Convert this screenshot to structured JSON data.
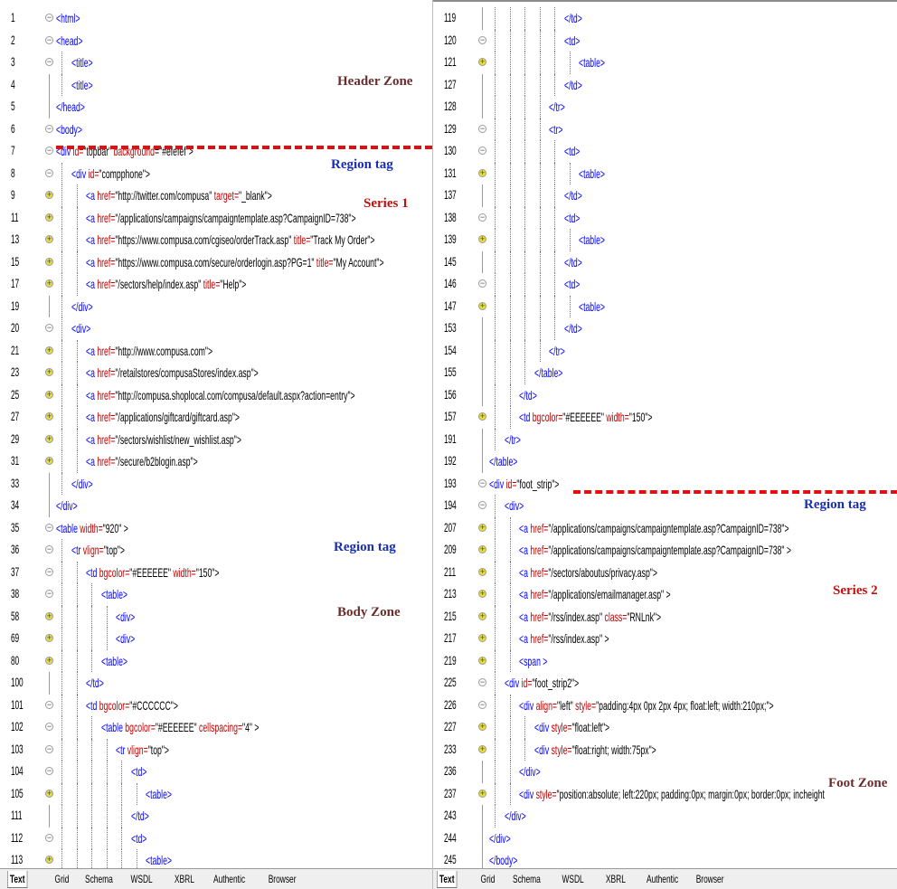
{
  "left": {
    "lines": [
      {
        "n": "1",
        "g": "exp",
        "d": 0,
        "t": [
          [
            "tag",
            "<html>"
          ]
        ]
      },
      {
        "n": "2",
        "g": "exp",
        "d": 0,
        "t": [
          [
            "tag",
            "<head>"
          ]
        ]
      },
      {
        "n": "3",
        "g": "exp",
        "d": 1,
        "t": [
          [
            "tag",
            "<title>"
          ]
        ]
      },
      {
        "n": "4",
        "g": "bar",
        "d": 1,
        "t": [
          [
            "tag",
            "<title>"
          ]
        ]
      },
      {
        "n": "5",
        "g": "bar",
        "d": 0,
        "t": [
          [
            "tag",
            "</head>"
          ]
        ]
      },
      {
        "n": "6",
        "g": "exp",
        "d": 0,
        "t": [
          [
            "tag",
            "<body>"
          ]
        ]
      },
      {
        "n": "7",
        "g": "exp",
        "d": 0,
        "t": [
          [
            "tag",
            "<div "
          ],
          [
            "a",
            "id="
          ],
          [
            "v",
            "\"topbar\" "
          ],
          [
            "a",
            "background"
          ],
          [
            "v",
            "=\"#efefef\">"
          ]
        ]
      },
      {
        "n": "8",
        "g": "exp",
        "d": 1,
        "t": [
          [
            "tag",
            "<div "
          ],
          [
            "a",
            "id="
          ],
          [
            "v",
            "\"compphone\">"
          ]
        ]
      },
      {
        "n": "9",
        "g": "col",
        "d": 2,
        "t": [
          [
            "tag",
            "<a "
          ],
          [
            "a",
            "href="
          ],
          [
            "v",
            "\"http://twitter.com/compusa\" "
          ],
          [
            "a",
            "target="
          ],
          [
            "v",
            "\"_blank\">"
          ]
        ]
      },
      {
        "n": "11",
        "g": "col",
        "d": 2,
        "t": [
          [
            "tag",
            "<a "
          ],
          [
            "a",
            "href="
          ],
          [
            "v",
            "\"/applications/campaigns/campaigntemplate.asp?CampaignID=738\">"
          ]
        ]
      },
      {
        "n": "13",
        "g": "col",
        "d": 2,
        "t": [
          [
            "tag",
            "<a "
          ],
          [
            "a",
            "href="
          ],
          [
            "v",
            "\"https://www.compusa.com/cgiseo/orderTrack.asp\" "
          ],
          [
            "a",
            "title="
          ],
          [
            "v",
            "\"Track My Order\">"
          ]
        ]
      },
      {
        "n": "15",
        "g": "col",
        "d": 2,
        "t": [
          [
            "tag",
            "<a "
          ],
          [
            "a",
            "href="
          ],
          [
            "v",
            "\"https://www.compusa.com/secure/orderlogin.asp?PG=1\" "
          ],
          [
            "a",
            "title="
          ],
          [
            "v",
            "\"My Account\">"
          ]
        ]
      },
      {
        "n": "17",
        "g": "col",
        "d": 2,
        "t": [
          [
            "tag",
            "<a "
          ],
          [
            "a",
            "href="
          ],
          [
            "v",
            "\"/sectors/help/index.asp\" "
          ],
          [
            "a",
            "title="
          ],
          [
            "v",
            "\"Help\">"
          ]
        ]
      },
      {
        "n": "19",
        "g": "bar",
        "d": 1,
        "t": [
          [
            "tag",
            "</div>"
          ]
        ]
      },
      {
        "n": "20",
        "g": "exp",
        "d": 1,
        "t": [
          [
            "tag",
            "<div>"
          ]
        ]
      },
      {
        "n": "21",
        "g": "col",
        "d": 2,
        "t": [
          [
            "tag",
            "<a "
          ],
          [
            "a",
            "href="
          ],
          [
            "v",
            "\"http://www.compusa.com\">"
          ]
        ]
      },
      {
        "n": "23",
        "g": "col",
        "d": 2,
        "t": [
          [
            "tag",
            "<a "
          ],
          [
            "a",
            "href="
          ],
          [
            "v",
            "\"/retailstores/compusaStores/index.asp\">"
          ]
        ]
      },
      {
        "n": "25",
        "g": "col",
        "d": 2,
        "t": [
          [
            "tag",
            "<a "
          ],
          [
            "a",
            "href="
          ],
          [
            "v",
            "\"http://compusa.shoplocal.com/compusa/default.aspx?action=entry\">"
          ]
        ]
      },
      {
        "n": "27",
        "g": "col",
        "d": 2,
        "t": [
          [
            "tag",
            "<a "
          ],
          [
            "a",
            "href="
          ],
          [
            "v",
            "\"/applications/giftcard/giftcard.asp\">"
          ]
        ]
      },
      {
        "n": "29",
        "g": "col",
        "d": 2,
        "t": [
          [
            "tag",
            "<a "
          ],
          [
            "a",
            "href="
          ],
          [
            "v",
            "\"/sectors/wishlist/new_wishlist.asp\">"
          ]
        ]
      },
      {
        "n": "31",
        "g": "col",
        "d": 2,
        "t": [
          [
            "tag",
            "<a "
          ],
          [
            "a",
            "href="
          ],
          [
            "v",
            "\"/secure/b2blogin.asp\">"
          ]
        ]
      },
      {
        "n": "33",
        "g": "bar",
        "d": 1,
        "t": [
          [
            "tag",
            "</div>"
          ]
        ]
      },
      {
        "n": "34",
        "g": "bar",
        "d": 0,
        "t": [
          [
            "tag",
            "</div>"
          ]
        ]
      },
      {
        "n": "35",
        "g": "exp",
        "d": 0,
        "t": [
          [
            "tag",
            "<table "
          ],
          [
            "a",
            "width="
          ],
          [
            "v",
            "\"920\" >"
          ]
        ]
      },
      {
        "n": "36",
        "g": "exp",
        "d": 1,
        "t": [
          [
            "tag",
            "<tr "
          ],
          [
            "a",
            "vlign="
          ],
          [
            "v",
            "\"top\">"
          ]
        ]
      },
      {
        "n": "37",
        "g": "exp",
        "d": 2,
        "t": [
          [
            "tag",
            "<td "
          ],
          [
            "a",
            "bgcolor="
          ],
          [
            "v",
            "\"#EEEEEE\" "
          ],
          [
            "a",
            "width="
          ],
          [
            "v",
            "\"150\">"
          ]
        ]
      },
      {
        "n": "38",
        "g": "exp",
        "d": 3,
        "t": [
          [
            "tag",
            "<table>"
          ]
        ]
      },
      {
        "n": "58",
        "g": "col",
        "d": 4,
        "t": [
          [
            "tag",
            "<div>"
          ]
        ]
      },
      {
        "n": "69",
        "g": "col",
        "d": 4,
        "t": [
          [
            "tag",
            "<div>"
          ]
        ]
      },
      {
        "n": "80",
        "g": "col",
        "d": 3,
        "t": [
          [
            "tag",
            "<table>"
          ]
        ]
      },
      {
        "n": "100",
        "g": "bar",
        "d": 2,
        "t": [
          [
            "tag",
            "</td>"
          ]
        ]
      },
      {
        "n": "101",
        "g": "exp",
        "d": 2,
        "t": [
          [
            "tag",
            "<td "
          ],
          [
            "a",
            "bgcolor="
          ],
          [
            "v",
            "\"#CCCCCC\">"
          ]
        ]
      },
      {
        "n": "102",
        "g": "exp",
        "d": 3,
        "t": [
          [
            "tag",
            "<table "
          ],
          [
            "a",
            "bgcolor="
          ],
          [
            "v",
            "\"#EEEEEE\" "
          ],
          [
            "a",
            "cellspacing="
          ],
          [
            "v",
            "\"4\" >"
          ]
        ]
      },
      {
        "n": "103",
        "g": "exp",
        "d": 4,
        "t": [
          [
            "tag",
            "<tr "
          ],
          [
            "a",
            "vlign="
          ],
          [
            "v",
            "\"top\">"
          ]
        ]
      },
      {
        "n": "104",
        "g": "exp",
        "d": 5,
        "t": [
          [
            "tag",
            "<td>"
          ]
        ]
      },
      {
        "n": "105",
        "g": "col",
        "d": 6,
        "t": [
          [
            "tag",
            "<table>"
          ]
        ]
      },
      {
        "n": "111",
        "g": "bar",
        "d": 5,
        "t": [
          [
            "tag",
            "</td>"
          ]
        ]
      },
      {
        "n": "112",
        "g": "exp",
        "d": 5,
        "t": [
          [
            "tag",
            "<td>"
          ]
        ]
      },
      {
        "n": "113",
        "g": "col",
        "d": 6,
        "t": [
          [
            "tag",
            "<table>"
          ]
        ]
      }
    ],
    "annotations": {
      "header_zone": "Header Zone",
      "region_tag_1": "Region tag",
      "series_1": "Series 1",
      "region_tag_2": "Region tag",
      "body_zone": "Body Zone"
    },
    "tabs": [
      "Text",
      "Grid",
      "Schema",
      "WSDL",
      "XBRL",
      "Authentic",
      "Browser"
    ],
    "active_tab": "Text"
  },
  "right": {
    "lines": [
      {
        "n": "119",
        "g": "bar",
        "d": 5,
        "t": [
          [
            "tag",
            "</td>"
          ]
        ]
      },
      {
        "n": "120",
        "g": "exp",
        "d": 5,
        "t": [
          [
            "tag",
            "<td>"
          ]
        ]
      },
      {
        "n": "121",
        "g": "col",
        "d": 6,
        "t": [
          [
            "tag",
            "<table>"
          ]
        ]
      },
      {
        "n": "127",
        "g": "bar",
        "d": 5,
        "t": [
          [
            "tag",
            "</td>"
          ]
        ]
      },
      {
        "n": "128",
        "g": "bar",
        "d": 4,
        "t": [
          [
            "tag",
            "</tr>"
          ]
        ]
      },
      {
        "n": "129",
        "g": "exp",
        "d": 4,
        "t": [
          [
            "tag",
            "<tr>"
          ]
        ]
      },
      {
        "n": "130",
        "g": "exp",
        "d": 5,
        "t": [
          [
            "tag",
            "<td>"
          ]
        ]
      },
      {
        "n": "131",
        "g": "col",
        "d": 6,
        "t": [
          [
            "tag",
            "<table>"
          ]
        ]
      },
      {
        "n": "137",
        "g": "bar",
        "d": 5,
        "t": [
          [
            "tag",
            "</td>"
          ]
        ]
      },
      {
        "n": "138",
        "g": "exp",
        "d": 5,
        "t": [
          [
            "tag",
            "<td>"
          ]
        ]
      },
      {
        "n": "139",
        "g": "col",
        "d": 6,
        "t": [
          [
            "tag",
            "<table>"
          ]
        ]
      },
      {
        "n": "145",
        "g": "bar",
        "d": 5,
        "t": [
          [
            "tag",
            "</td>"
          ]
        ]
      },
      {
        "n": "146",
        "g": "exp",
        "d": 5,
        "t": [
          [
            "tag",
            "<td>"
          ]
        ]
      },
      {
        "n": "147",
        "g": "col",
        "d": 6,
        "t": [
          [
            "tag",
            "<table>"
          ]
        ]
      },
      {
        "n": "153",
        "g": "bar",
        "d": 5,
        "t": [
          [
            "tag",
            "</td>"
          ]
        ]
      },
      {
        "n": "154",
        "g": "bar",
        "d": 4,
        "t": [
          [
            "tag",
            "</tr>"
          ]
        ]
      },
      {
        "n": "155",
        "g": "bar",
        "d": 3,
        "t": [
          [
            "tag",
            "</table>"
          ]
        ]
      },
      {
        "n": "156",
        "g": "bar",
        "d": 2,
        "t": [
          [
            "tag",
            "</td>"
          ]
        ]
      },
      {
        "n": "157",
        "g": "col",
        "d": 2,
        "t": [
          [
            "tag",
            "<td "
          ],
          [
            "a",
            "bgcolor="
          ],
          [
            "v",
            "\"#EEEEEE\" "
          ],
          [
            "a",
            "width="
          ],
          [
            "v",
            "\"150\">"
          ]
        ]
      },
      {
        "n": "191",
        "g": "bar",
        "d": 1,
        "t": [
          [
            "tag",
            "</tr>"
          ]
        ]
      },
      {
        "n": "192",
        "g": "bar",
        "d": 0,
        "t": [
          [
            "tag",
            "</table>"
          ]
        ]
      },
      {
        "n": "193",
        "g": "exp",
        "d": 0,
        "t": [
          [
            "tag",
            "<div "
          ],
          [
            "a",
            "id="
          ],
          [
            "v",
            "\"foot_strip\">"
          ]
        ]
      },
      {
        "n": "194",
        "g": "exp",
        "d": 1,
        "t": [
          [
            "tag",
            "<div>"
          ]
        ]
      },
      {
        "n": "207",
        "g": "col",
        "d": 2,
        "t": [
          [
            "tag",
            "<a "
          ],
          [
            "a",
            "href="
          ],
          [
            "v",
            "\"/applications/campaigns/campaigntemplate.asp?CampaignID=738\">"
          ]
        ]
      },
      {
        "n": "209",
        "g": "col",
        "d": 2,
        "t": [
          [
            "tag",
            "<a "
          ],
          [
            "a",
            "href="
          ],
          [
            "v",
            "\"/applications/campaigns/campaigntemplate.asp?CampaignID=738\" >"
          ]
        ]
      },
      {
        "n": "211",
        "g": "col",
        "d": 2,
        "t": [
          [
            "tag",
            "<a "
          ],
          [
            "a",
            "href="
          ],
          [
            "v",
            "\"/sectors/aboutus/privacy.asp\">"
          ]
        ]
      },
      {
        "n": "213",
        "g": "col",
        "d": 2,
        "t": [
          [
            "tag",
            "<a "
          ],
          [
            "a",
            "href="
          ],
          [
            "v",
            "\"/applications/emailmanager.asp\" >"
          ]
        ]
      },
      {
        "n": "215",
        "g": "col",
        "d": 2,
        "t": [
          [
            "tag",
            "<a "
          ],
          [
            "a",
            "href="
          ],
          [
            "v",
            "\"/rss/index.asp\" "
          ],
          [
            "a",
            "class="
          ],
          [
            "v",
            "\"RNLnk\">"
          ]
        ]
      },
      {
        "n": "217",
        "g": "col",
        "d": 2,
        "t": [
          [
            "tag",
            "<a "
          ],
          [
            "a",
            "href="
          ],
          [
            "v",
            "\"/rss/index.asp\" >"
          ]
        ]
      },
      {
        "n": "219",
        "g": "col",
        "d": 2,
        "t": [
          [
            "tag",
            "<span >"
          ]
        ]
      },
      {
        "n": "225",
        "g": "exp",
        "d": 1,
        "t": [
          [
            "tag",
            "<div "
          ],
          [
            "a",
            "id="
          ],
          [
            "v",
            "\"foot_strip2\">"
          ]
        ]
      },
      {
        "n": "226",
        "g": "exp",
        "d": 2,
        "t": [
          [
            "tag",
            "<div "
          ],
          [
            "a",
            "align="
          ],
          [
            "v",
            "\"left\" "
          ],
          [
            "a",
            "style="
          ],
          [
            "v",
            "\"padding:4px 0px 2px 4px; float:left; width:210px;\">"
          ]
        ]
      },
      {
        "n": "227",
        "g": "col",
        "d": 3,
        "t": [
          [
            "tag",
            "<div "
          ],
          [
            "a",
            "style="
          ],
          [
            "v",
            "\"float:left\">"
          ]
        ]
      },
      {
        "n": "233",
        "g": "col",
        "d": 3,
        "t": [
          [
            "tag",
            "<div "
          ],
          [
            "a",
            "style="
          ],
          [
            "v",
            "\"float:right; width:75px\">"
          ]
        ]
      },
      {
        "n": "236",
        "g": "bar",
        "d": 2,
        "t": [
          [
            "tag",
            "</div>"
          ]
        ]
      },
      {
        "n": "237",
        "g": "col",
        "d": 2,
        "t": [
          [
            "tag",
            "<div "
          ],
          [
            "a",
            "style="
          ],
          [
            "v",
            "\"position:absolute; left:220px; padding:0px; margin:0px; border:0px; incheight"
          ]
        ]
      },
      {
        "n": "243",
        "g": "bar",
        "d": 1,
        "t": [
          [
            "tag",
            "</div>"
          ]
        ]
      },
      {
        "n": "244",
        "g": "bar",
        "d": 0,
        "t": [
          [
            "tag",
            "</div>"
          ]
        ]
      },
      {
        "n": "245",
        "g": "bar",
        "d": 0,
        "t": [
          [
            "tag",
            "</body>"
          ]
        ]
      }
    ],
    "annotations": {
      "region_tag": "Region tag",
      "series_2": "Series 2",
      "foot_zone": "Foot Zone"
    },
    "tabs": [
      "Text",
      "Grid",
      "Schema",
      "WSDL",
      "XBRL",
      "Authentic",
      "Browser"
    ],
    "active_tab": "Text"
  },
  "colors": {
    "tag": "#0000ff",
    "attr": "#c00000",
    "dash": "#e01010",
    "collapsed_marker": "#e6de3c"
  }
}
